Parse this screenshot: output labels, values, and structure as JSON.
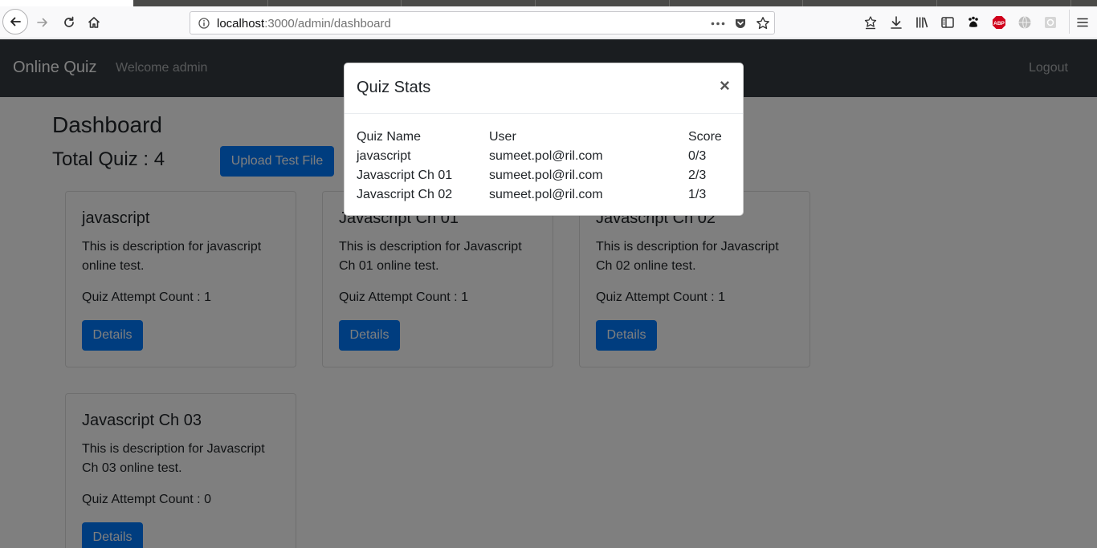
{
  "browser": {
    "url_host": "localhost",
    "url_path": ":3000/admin/dashboard",
    "abp_label": "ABP"
  },
  "navbar": {
    "brand": "Online Quiz",
    "welcome": "Welcome admin",
    "logout": "Logout"
  },
  "dashboard": {
    "title": "Dashboard",
    "total_label": "Total Quiz : 4",
    "upload_button": "Upload Test File"
  },
  "cards": [
    {
      "title": "javascript",
      "description": "This is description for javascript online test.",
      "attempt": "Quiz Attempt Count : 1",
      "button": "Details"
    },
    {
      "title": "Javascript Ch 01",
      "description": "This is description for Javascript Ch 01 online test.",
      "attempt": "Quiz Attempt Count : 1",
      "button": "Details"
    },
    {
      "title": "Javascript Ch 02",
      "description": "This is description for Javascript Ch 02 online test.",
      "attempt": "Quiz Attempt Count : 1",
      "button": "Details"
    },
    {
      "title": "Javascript Ch 03",
      "description": "This is description for Javascript Ch 03 online test.",
      "attempt": "Quiz Attempt Count : 0",
      "button": "Details"
    }
  ],
  "modal": {
    "title": "Quiz Stats",
    "close": "×",
    "headers": {
      "quiz_name": "Quiz Name",
      "user": "User",
      "score": "Score"
    },
    "rows": [
      {
        "quiz_name": "javascript",
        "user": "sumeet.pol@ril.com",
        "score": "0/3"
      },
      {
        "quiz_name": "Javascript Ch 01",
        "user": "sumeet.pol@ril.com",
        "score": "2/3"
      },
      {
        "quiz_name": "Javascript Ch 02",
        "user": "sumeet.pol@ril.com",
        "score": "1/3"
      }
    ]
  }
}
